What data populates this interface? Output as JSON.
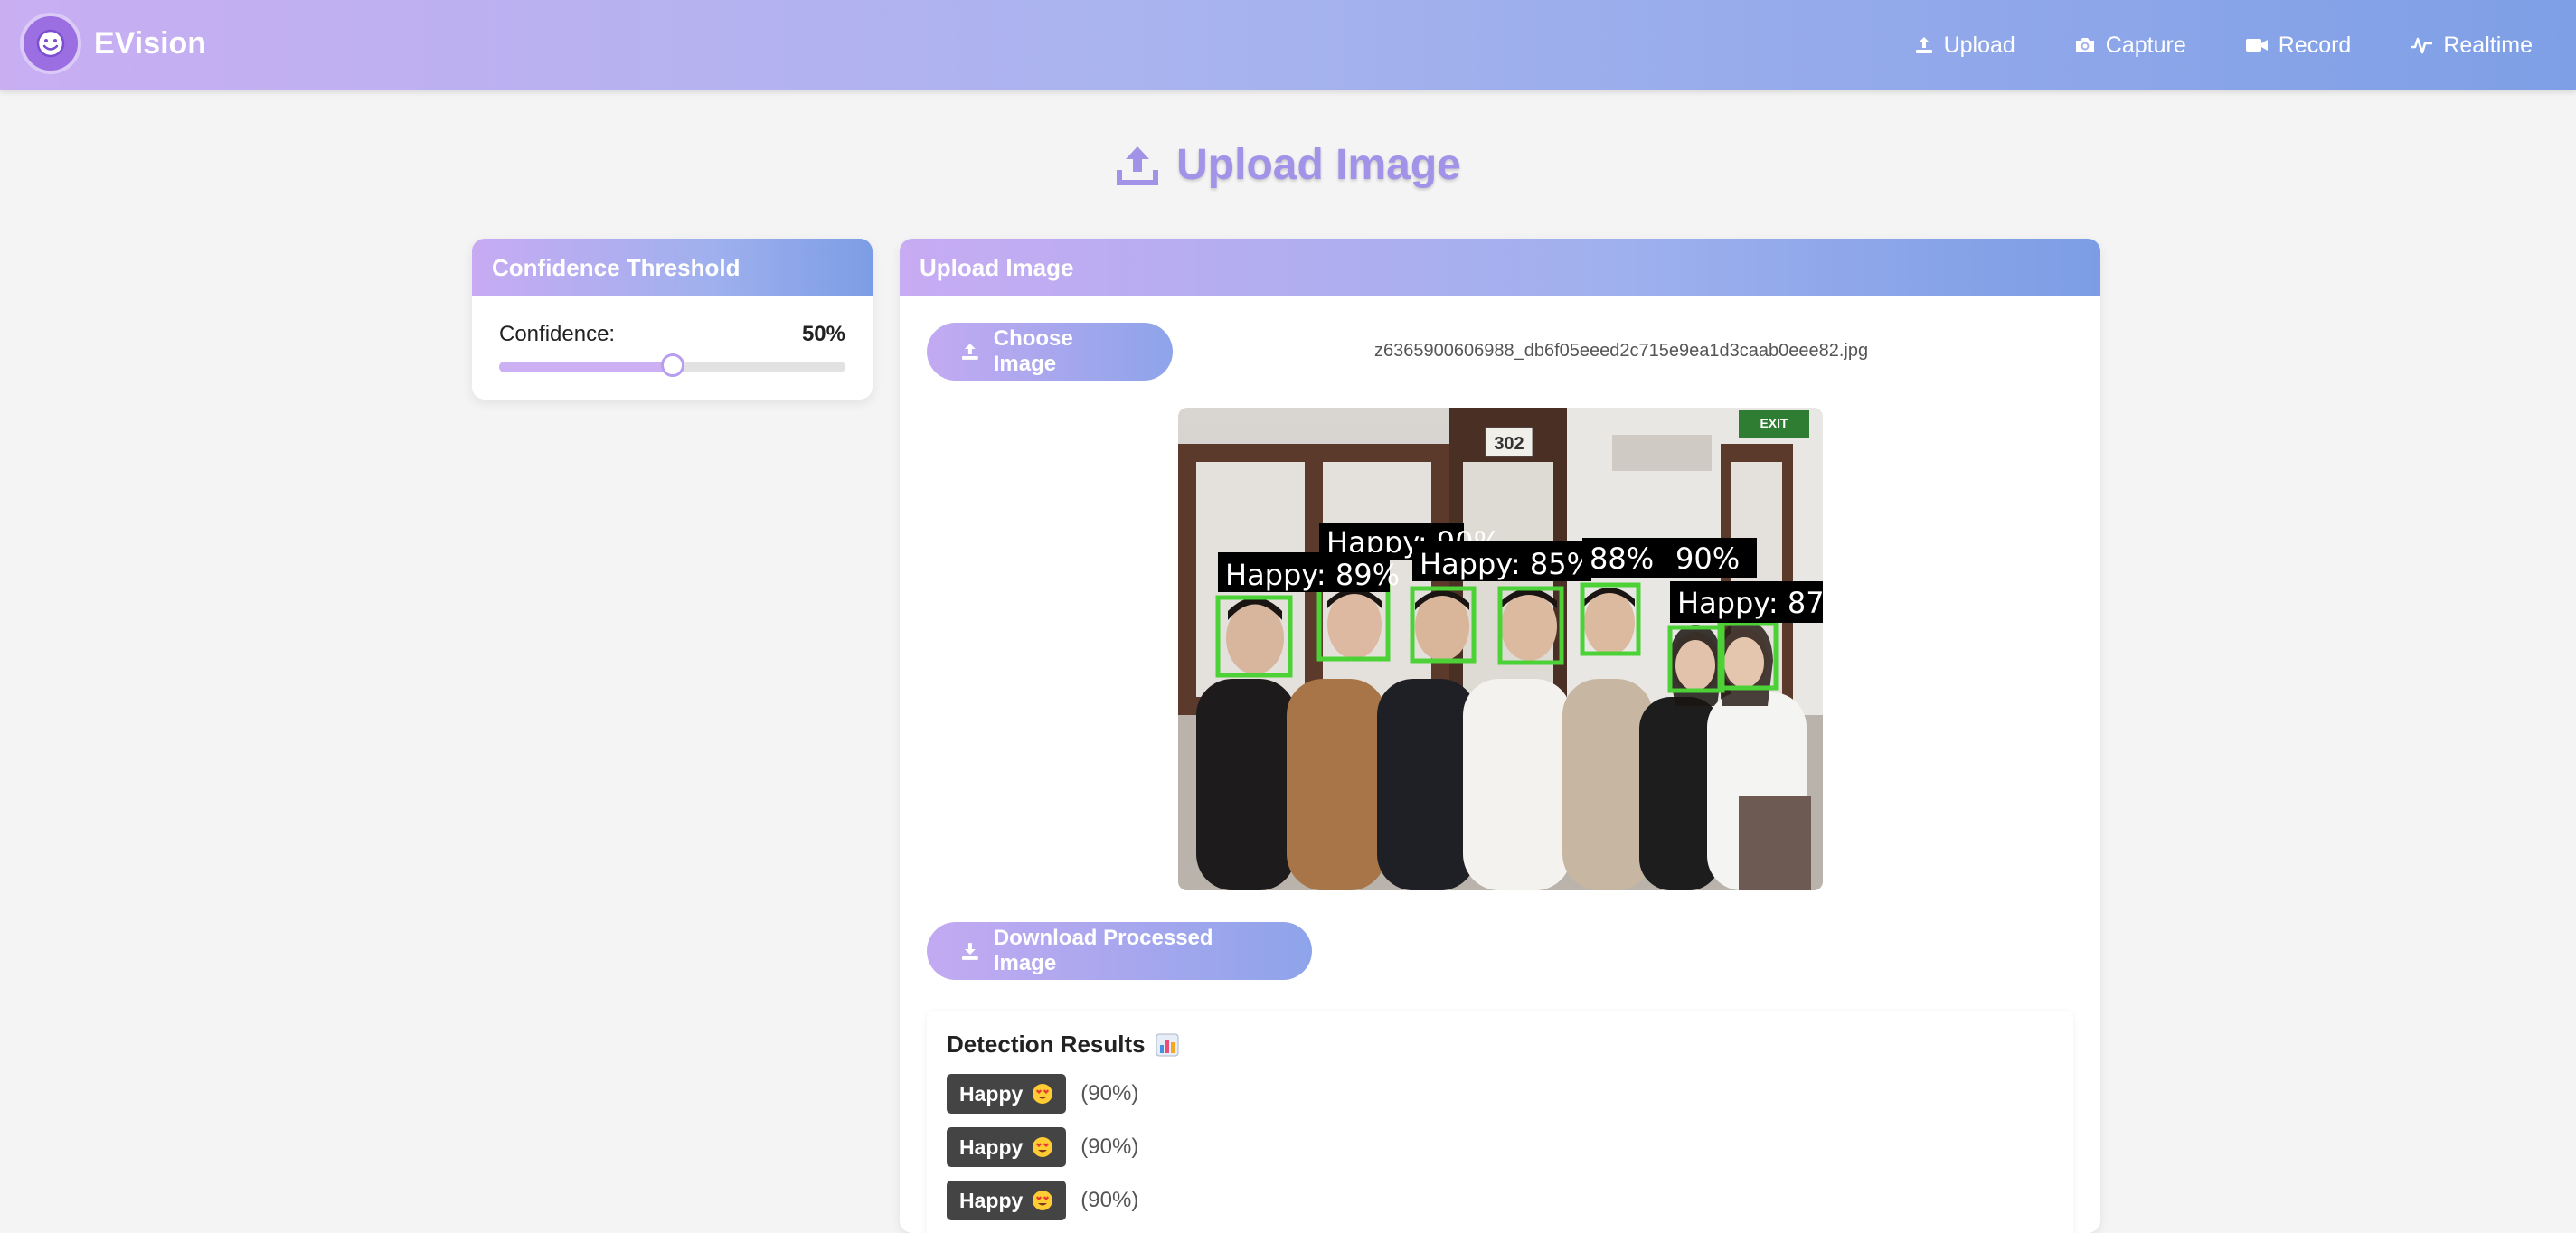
{
  "app": {
    "name": "EVision"
  },
  "nav": {
    "items": [
      {
        "label": "Upload",
        "icon": "upload-icon"
      },
      {
        "label": "Capture",
        "icon": "camera-icon"
      },
      {
        "label": "Record",
        "icon": "video-icon"
      },
      {
        "label": "Realtime",
        "icon": "waveform-icon"
      }
    ]
  },
  "page": {
    "title": "Upload Image"
  },
  "confidence": {
    "header": "Confidence Threshold",
    "label": "Confidence:",
    "value_text": "50%",
    "value": 0.5
  },
  "upload": {
    "header": "Upload Image",
    "choose_button": "Choose Image",
    "file_name": "z6365900606988_db6f05eeed2c715e9ea1d3caab0eee82.jpg",
    "download_button": "Download Processed Image",
    "image_labels": [
      "Happy: 90%",
      "Happy: 89%",
      "Happy: 85%",
      "88%",
      "90%",
      "Happy: 87"
    ],
    "image_signs": [
      "302",
      "EXIT"
    ]
  },
  "results": {
    "title": "Detection Results",
    "items": [
      {
        "label": "Happy",
        "percent": "(90%)"
      },
      {
        "label": "Happy",
        "percent": "(90%)"
      },
      {
        "label": "Happy",
        "percent": "(90%)"
      }
    ]
  },
  "colors": {
    "accent": "#a293e8",
    "gradient_start": "#c9aef2",
    "gradient_end": "#7e9fe6",
    "detection_box": "#4cd137",
    "badge": "#444444"
  }
}
